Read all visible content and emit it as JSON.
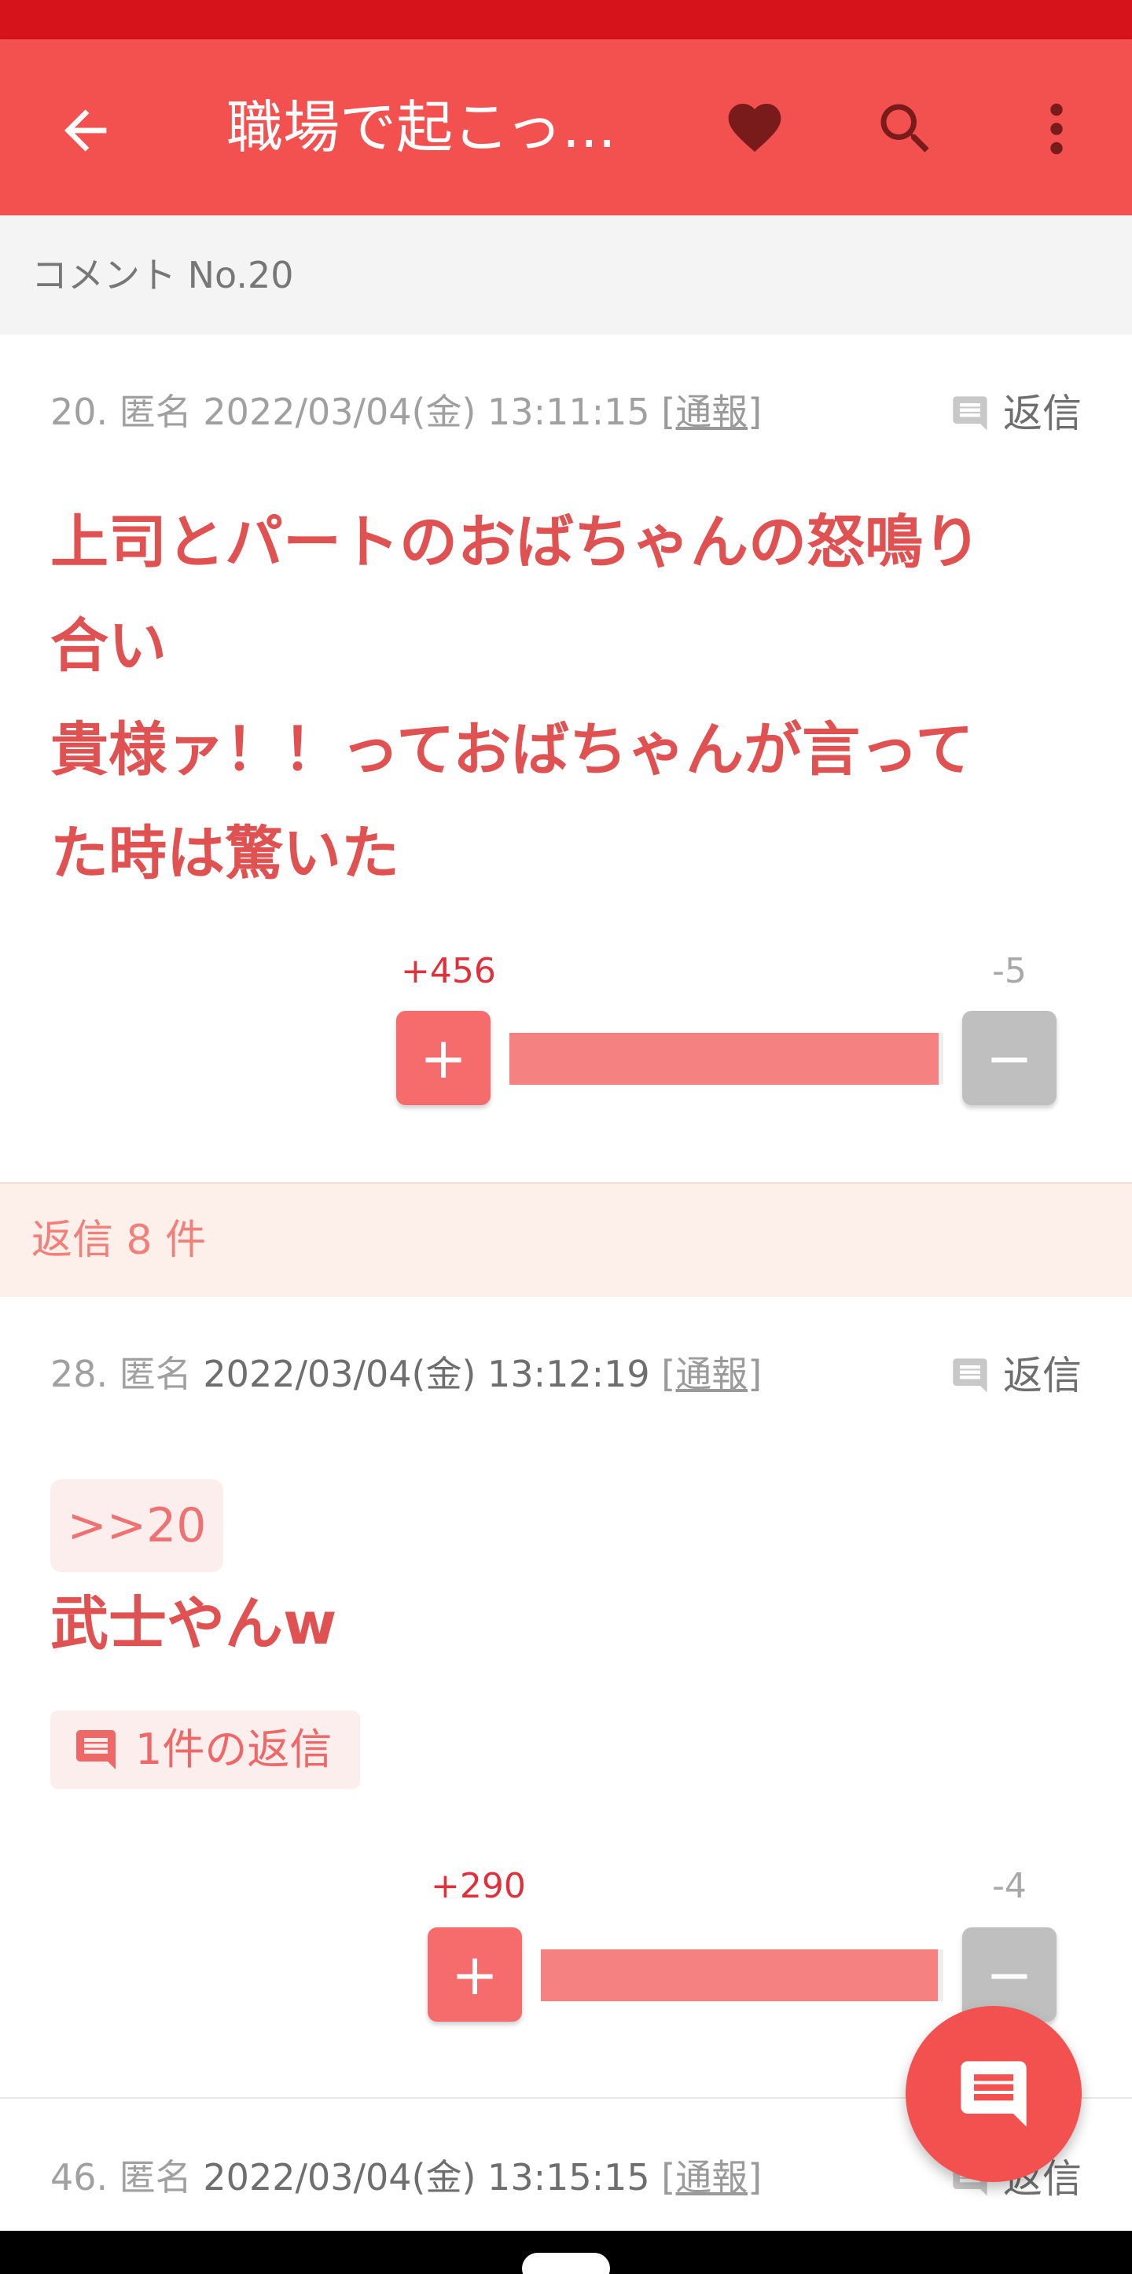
{
  "app_bar": {
    "title": "職場で起こっ..."
  },
  "section": {
    "label": "コメント No.20"
  },
  "comments": [
    {
      "number": "20.",
      "author": "匿名",
      "datetime": "2022/03/04(金) 13:11:15",
      "report": "[通報]",
      "reply_label": "返信",
      "body_lines": [
        "上司とパートのおばちゃんの怒鳴り",
        "合い",
        "貴様ァ！！っておばちゃんが言って",
        "た時は驚いた"
      ],
      "plus": "+456",
      "minus": "-5",
      "plus_ratio": 0.989
    },
    {
      "number": "28.",
      "author": "匿名",
      "datetime": "2022/03/04(金) 13:12:19",
      "report": "[通報]",
      "reply_label": "返信",
      "anchor": ">>20",
      "body_lines": [
        "武士やんw"
      ],
      "reply_count": "1件の返信",
      "plus": "+290",
      "minus": "-4",
      "plus_ratio": 0.986
    },
    {
      "number": "46.",
      "author": "匿名",
      "datetime": "2022/03/04(金) 13:15:15",
      "report": "[通報]",
      "reply_label": "返信"
    }
  ],
  "replies_header": "返信 8 件",
  "vote_buttons": {
    "plus": "+",
    "minus": "−"
  },
  "icons": {
    "back": "arrow-back-icon",
    "favorite": "heart-icon",
    "search": "search-icon",
    "more": "more-vert-icon",
    "comment": "comment-icon",
    "fab": "comment-fab-icon"
  },
  "colors": {
    "status_bar": "#d6121a",
    "app_bar": "#f25150",
    "body_text": "#e05252",
    "vote_plus": "#f66b6b",
    "vote_minus": "#bfbfbf"
  }
}
